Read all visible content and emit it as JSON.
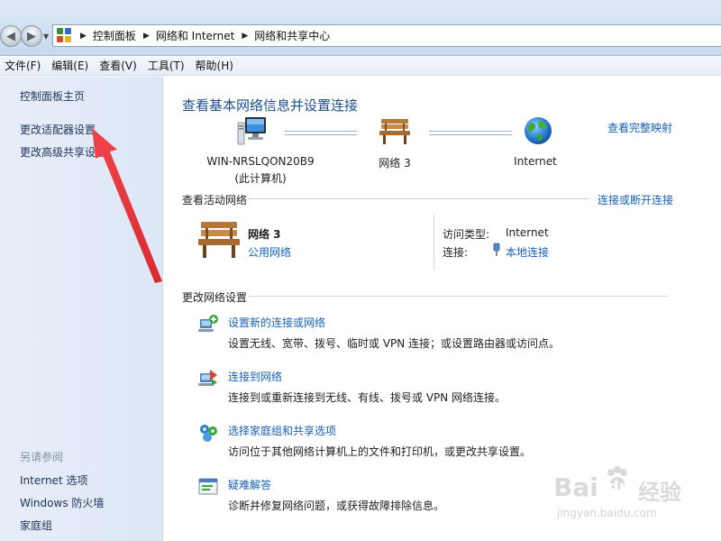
{
  "breadcrumb": [
    "控制面板",
    "网络和 Internet",
    "网络和共享中心"
  ],
  "menu": [
    "文件(F)",
    "编辑(E)",
    "查看(V)",
    "工具(T)",
    "帮助(H)"
  ],
  "sidebar": {
    "links": [
      "控制面板主页",
      "更改适配器设置",
      "更改高级共享设置"
    ],
    "see_also_title": "另请参阅",
    "see_also": [
      "Internet 选项",
      "Windows 防火墙",
      "家庭组"
    ]
  },
  "main": {
    "title": "查看基本网络信息并设置连接",
    "full_map_link": "查看完整映射",
    "network_map": {
      "computer_name": "WIN-NRSLQON20B9",
      "computer_sub": "(此计算机)",
      "network_name": "网络  3",
      "internet_label": "Internet"
    },
    "active_networks": {
      "heading": "查看活动网络",
      "connect_link": "连接或断开连接",
      "name": "网络  3",
      "type_link": "公用网络",
      "access_type_label": "访问类型:",
      "access_type_value": "Internet",
      "connection_label": "连接:",
      "connection_value": "本地连接"
    },
    "change_settings": {
      "heading": "更改网络设置",
      "tasks": [
        {
          "title": "设置新的连接或网络",
          "desc": "设置无线、宽带、拨号、临时或 VPN 连接；或设置路由器或访问点。",
          "icon": "new-connection-icon"
        },
        {
          "title": "连接到网络",
          "desc": "连接到或重新连接到无线、有线、拨号或 VPN 网络连接。",
          "icon": "connect-network-icon"
        },
        {
          "title": "选择家庭组和共享选项",
          "desc": "访问位于其他网络计算机上的文件和打印机，或更改共享设置。",
          "icon": "homegroup-icon"
        },
        {
          "title": "疑难解答",
          "desc": "诊断并修复网络问题，或获得故障排除信息。",
          "icon": "troubleshoot-icon"
        }
      ]
    }
  },
  "watermark": {
    "brand": "Bai",
    "brand2": "du",
    "cn": "经验",
    "url": "jingyan.baidu.com"
  },
  "colors": {
    "link": "#1660b8",
    "title": "#1c4f8c",
    "annotation_arrow": "#e8383d"
  }
}
